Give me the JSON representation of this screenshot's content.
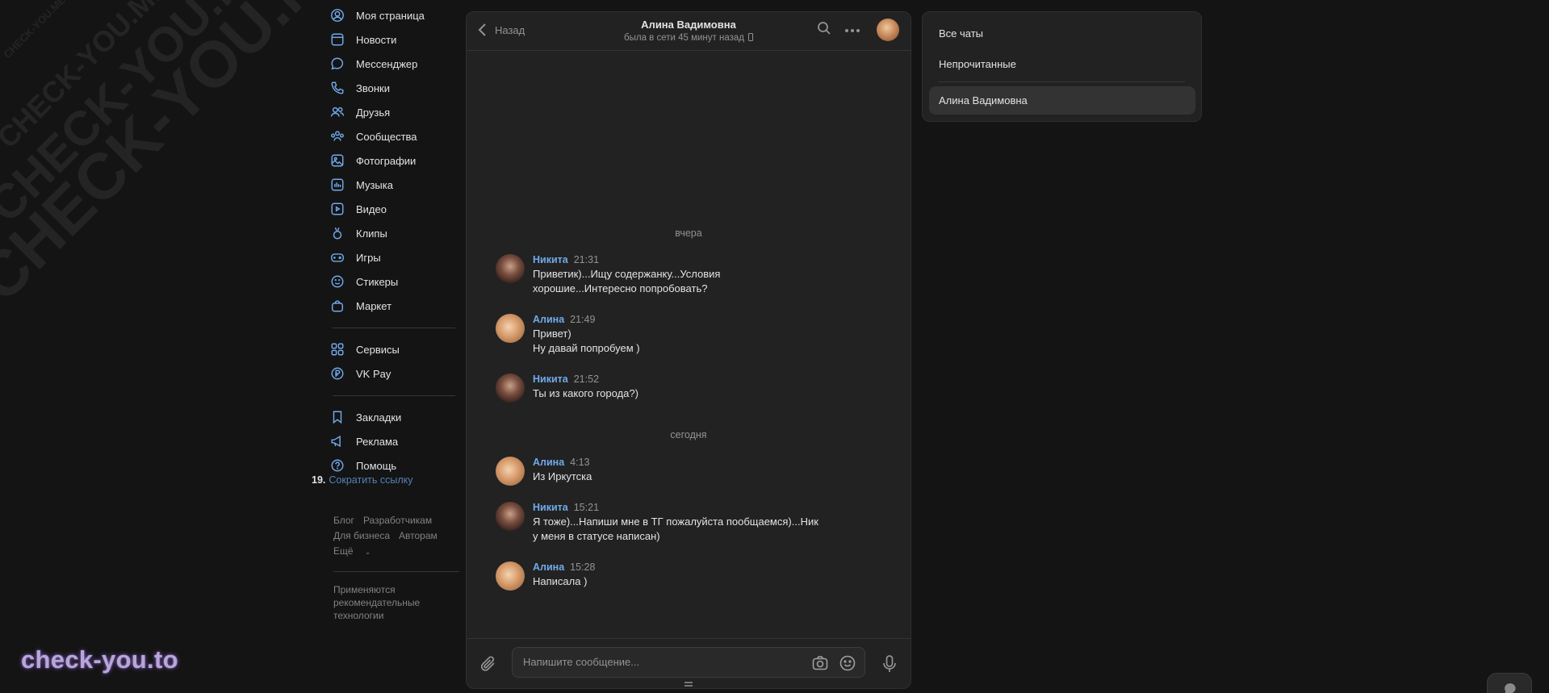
{
  "watermark": {
    "lines": [
      "CHECK-YOU.ME",
      "CHECK-YOU.ME",
      "CHECK-YOU.ME",
      "CHECK-YOU.ME"
    ],
    "brand": "check-you.to"
  },
  "nav": {
    "items": [
      {
        "label": "Моя страница",
        "icon": "user-circle-icon"
      },
      {
        "label": "Новости",
        "icon": "news-icon"
      },
      {
        "label": "Мессенджер",
        "icon": "message-icon"
      },
      {
        "label": "Звонки",
        "icon": "phone-icon"
      },
      {
        "label": "Друзья",
        "icon": "friends-icon"
      },
      {
        "label": "Сообщества",
        "icon": "communities-icon"
      },
      {
        "label": "Фотографии",
        "icon": "photo-icon"
      },
      {
        "label": "Музыка",
        "icon": "music-icon"
      },
      {
        "label": "Видео",
        "icon": "video-icon"
      },
      {
        "label": "Клипы",
        "icon": "clips-icon"
      },
      {
        "label": "Игры",
        "icon": "gamepad-icon"
      },
      {
        "label": "Стикеры",
        "icon": "smile-icon"
      },
      {
        "label": "Маркет",
        "icon": "bag-icon"
      }
    ],
    "items2": [
      {
        "label": "Сервисы",
        "icon": "services-icon"
      },
      {
        "label": "VK Pay",
        "icon": "vkpay-icon"
      }
    ],
    "items3": [
      {
        "label": "Закладки",
        "icon": "bookmark-icon"
      },
      {
        "label": "Реклама",
        "icon": "megaphone-icon"
      },
      {
        "label": "Помощь",
        "icon": "help-icon"
      }
    ],
    "short_link_num": "19.",
    "short_link": "Сократить ссылку",
    "footer_links": [
      "Блог",
      "Разработчикам",
      "Для бизнеса",
      "Авторам",
      "Ещё"
    ],
    "footer_note": "Применяются рекомендательные технологии"
  },
  "chat": {
    "back_label": "Назад",
    "peer_name": "Алина Вадимовна",
    "peer_status": "была в сети 45 минут назад",
    "days": [
      "вчера",
      "сегодня"
    ],
    "messages": [
      {
        "author": "Никита",
        "time": "21:31",
        "text": "Приветик)...Ищу содержанку...Условия хорошие...Интересно попробовать?"
      },
      {
        "author": "Алина",
        "time": "21:49",
        "text": "Привет)\nНу давай попробуем )"
      },
      {
        "author": "Никита",
        "time": "21:52",
        "text": "Ты из какого города?)"
      },
      {
        "author": "Алина",
        "time": "4:13",
        "text": "Из Иркутска"
      },
      {
        "author": "Никита",
        "time": "15:21",
        "text": "Я тоже)...Напиши мне в ТГ пожалуйста пообщаемся)...Ник у меня в статусе написан)"
      },
      {
        "author": "Алина",
        "time": "15:28",
        "text": "Написала )"
      }
    ],
    "input_placeholder": "Напишите сообщение..."
  },
  "folders": {
    "items": [
      "Все чаты",
      "Непрочитанные",
      "Алина Вадимовна"
    ],
    "active": "Алина Вадимовна"
  },
  "colors": {
    "accent": "#71aaeb",
    "background": "#141414",
    "panel": "#222222"
  }
}
